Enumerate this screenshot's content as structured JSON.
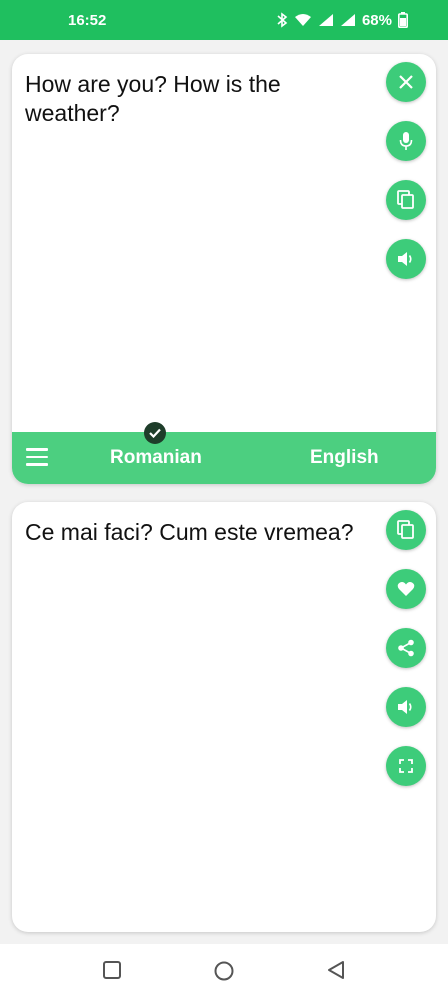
{
  "status_bar": {
    "time": "16:52",
    "battery": "68%"
  },
  "source_card": {
    "text": "How are you? How is the weather?",
    "actions": [
      "close-icon",
      "microphone-icon",
      "copy-icon",
      "speaker-icon"
    ]
  },
  "language_bar": {
    "source_language": "Romanian",
    "target_language": "English"
  },
  "target_card": {
    "text": "Ce mai faci? Cum este vremea?",
    "actions": [
      "copy-icon",
      "heart-icon",
      "share-icon",
      "speaker-icon",
      "fullscreen-icon"
    ]
  },
  "colors": {
    "accent": "#3dcc7a",
    "status_bar": "#1fbf5f",
    "lang_bar": "#4ccf80"
  }
}
